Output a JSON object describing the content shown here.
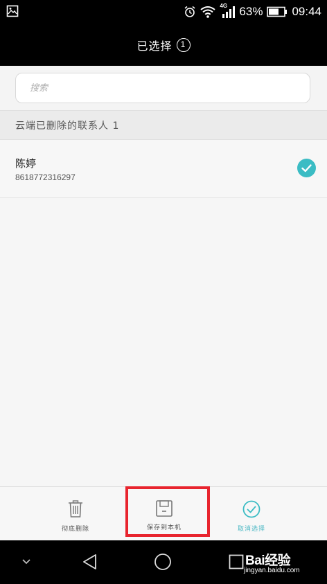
{
  "status_bar": {
    "network": "4G",
    "battery": "63%",
    "time": "09:44"
  },
  "header": {
    "title": "已选择",
    "count": "1"
  },
  "search": {
    "placeholder": "搜索"
  },
  "section": {
    "label": "云端已删除的联系人 1"
  },
  "contacts": [
    {
      "name": "陈婷",
      "number": "8618772316297",
      "selected": true
    }
  ],
  "actions": [
    {
      "label": "彻底删除",
      "icon": "trash-icon"
    },
    {
      "label": "保存到本机",
      "icon": "save-icon"
    },
    {
      "label": "取消选择",
      "icon": "check-circle-icon"
    }
  ],
  "watermark": {
    "logo": "Bai经验",
    "url": "jingyan.baidu.com"
  },
  "colors": {
    "accent": "#3bbcc4",
    "highlight": "#e8242e"
  }
}
